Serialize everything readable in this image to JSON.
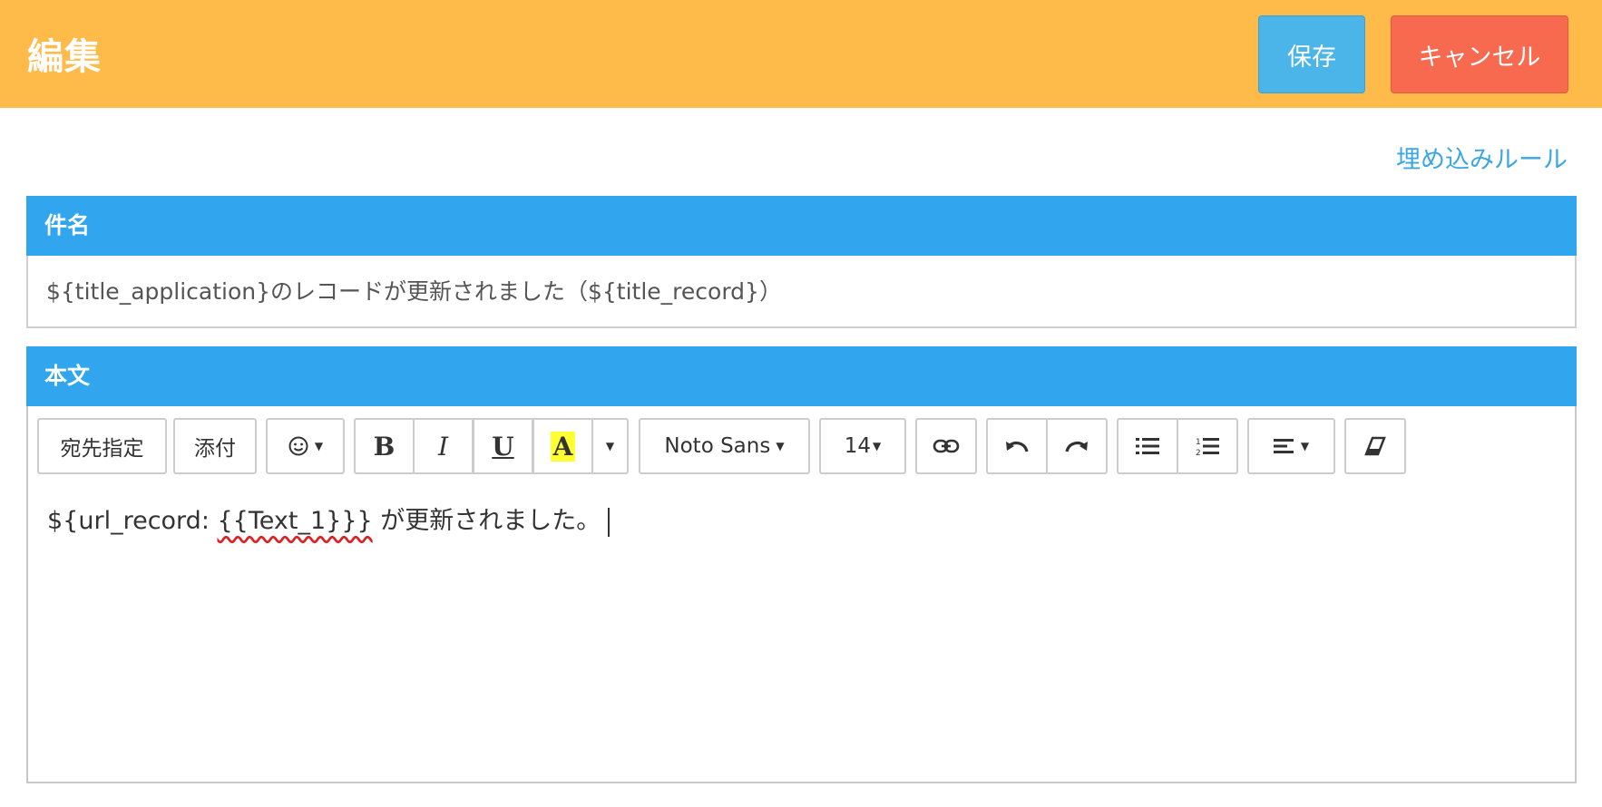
{
  "header": {
    "title": "編集",
    "save_label": "保存",
    "cancel_label": "キャンセル",
    "bg_color": "#ffbb4a"
  },
  "embed_rules_link": "埋め込みルール",
  "subject": {
    "label": "件名",
    "value": "${title_application}のレコードが更新されました（${title_record}）"
  },
  "body": {
    "label": "本文",
    "text_before": "${url_record: ",
    "text_misspelled": "{{Text_1}}}",
    "text_after": " が更新されました。"
  },
  "toolbar": {
    "recipient_label": "宛先指定",
    "attach_label": "添付",
    "emoji_icon": "smiley-icon",
    "bold_label": "B",
    "italic_label": "I",
    "underline_label": "U",
    "highlight_label": "A",
    "font_name": "Noto Sans",
    "font_size": "14",
    "link_icon": "link-icon",
    "undo_icon": "undo-icon",
    "redo_icon": "redo-icon",
    "bullet_list_icon": "bullet-list-icon",
    "numbered_list_icon": "numbered-list-icon",
    "align_icon": "align-icon",
    "eraser_icon": "eraser-icon"
  },
  "colors": {
    "section_bar": "#31a6ee",
    "save_button": "#4bb4e8",
    "cancel_button": "#f76a50",
    "link": "#3aa6e3",
    "highlight": "#ffff33"
  }
}
